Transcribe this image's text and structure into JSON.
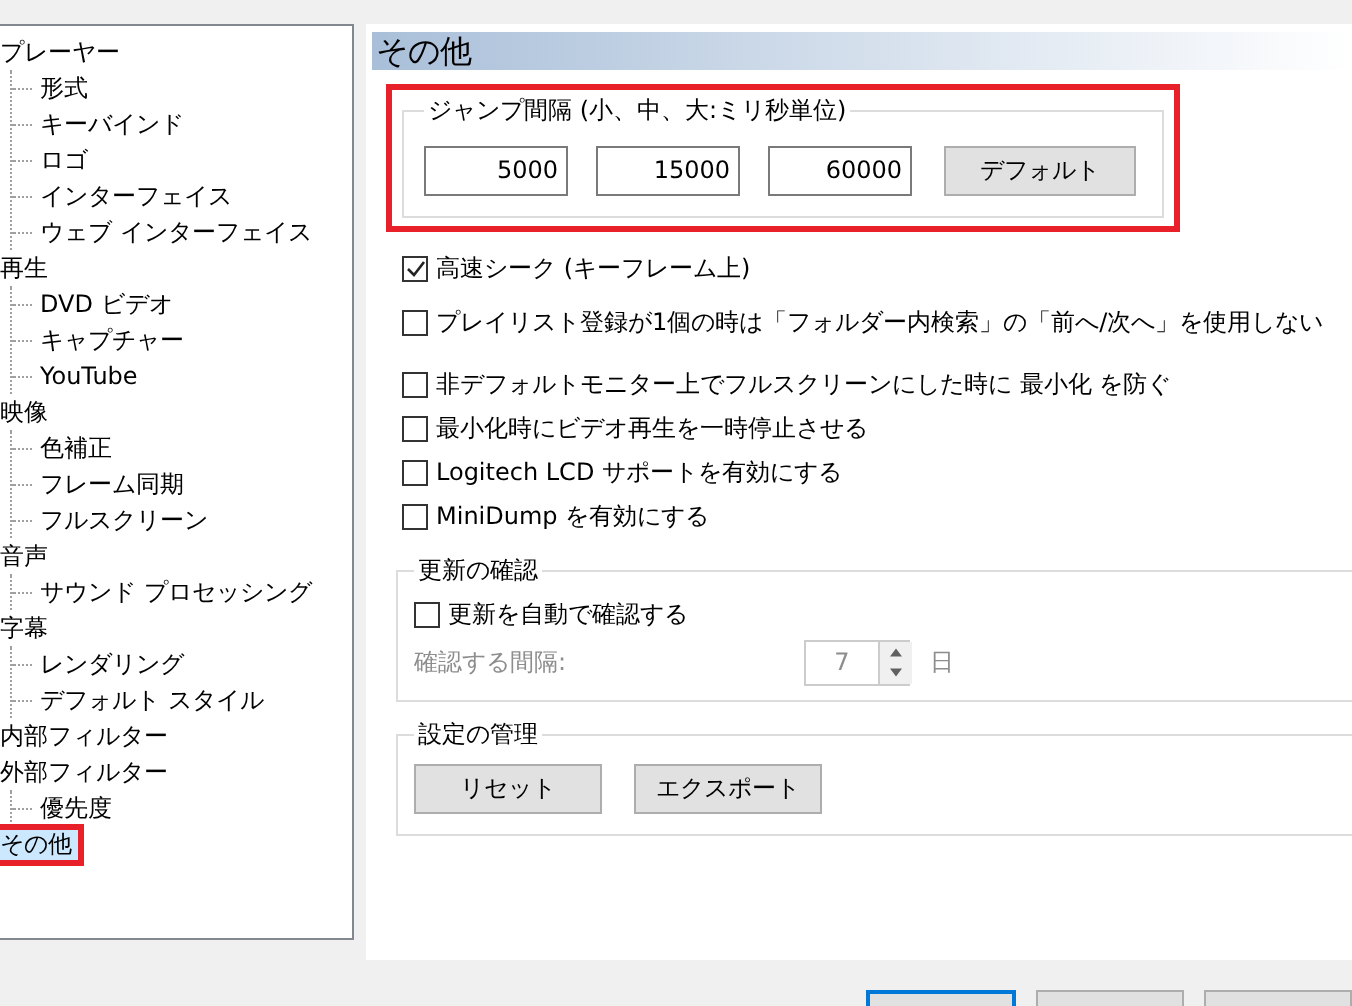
{
  "tree": [
    {
      "label": "プレーヤー",
      "selected": false,
      "highlighted": false,
      "children": [
        {
          "label": "形式",
          "selected": false
        },
        {
          "label": "キーバインド",
          "selected": false
        },
        {
          "label": "ロゴ",
          "selected": false
        },
        {
          "label": "インターフェイス",
          "selected": false
        },
        {
          "label": "ウェブ インターフェイス",
          "selected": false
        }
      ]
    },
    {
      "label": "再生",
      "selected": false,
      "highlighted": false,
      "children": [
        {
          "label": "DVD ビデオ",
          "selected": false
        },
        {
          "label": "キャプチャー",
          "selected": false
        },
        {
          "label": "YouTube",
          "selected": false
        }
      ]
    },
    {
      "label": "映像",
      "selected": false,
      "highlighted": false,
      "children": [
        {
          "label": "色補正",
          "selected": false
        },
        {
          "label": "フレーム同期",
          "selected": false
        },
        {
          "label": "フルスクリーン",
          "selected": false
        }
      ]
    },
    {
      "label": "音声",
      "selected": false,
      "highlighted": false,
      "children": [
        {
          "label": "サウンド プロセッシング",
          "selected": false
        }
      ]
    },
    {
      "label": "字幕",
      "selected": false,
      "highlighted": false,
      "children": [
        {
          "label": "レンダリング",
          "selected": false
        },
        {
          "label": "デフォルト スタイル",
          "selected": false
        }
      ]
    },
    {
      "label": "内部フィルター",
      "selected": false,
      "highlighted": false
    },
    {
      "label": "外部フィルター",
      "selected": false,
      "highlighted": false,
      "children": [
        {
          "label": "優先度",
          "selected": false
        }
      ]
    },
    {
      "label": "その他",
      "selected": true,
      "highlighted": true
    }
  ],
  "page_title": "その他",
  "jump_group": {
    "title": "ジャンプ間隔 (小、中、大:ミリ秒単位)",
    "highlighted": true,
    "values": [
      "5000",
      "15000",
      "60000"
    ],
    "button": "デフォルト"
  },
  "options": [
    {
      "label": "高速シーク (キーフレーム上)",
      "checked": true
    },
    {
      "label": "プレイリスト登録が1個の時は「フォルダー内検索」の「前へ/次へ」を使用しない",
      "checked": false
    },
    {
      "label": "非デフォルトモニター上でフルスクリーンにした時に 最小化 を防ぐ",
      "checked": false
    },
    {
      "label": "最小化時にビデオ再生を一時停止させる",
      "checked": false
    },
    {
      "label": "Logitech LCD サポートを有効にする",
      "checked": false
    },
    {
      "label": "MiniDump を有効にする",
      "checked": false
    }
  ],
  "update_group": {
    "title": "更新の確認",
    "auto_check": {
      "label": "更新を自動で確認する",
      "checked": false
    },
    "interval_label": "確認する間隔:",
    "interval_value": "7",
    "interval_unit": "日",
    "disabled": true
  },
  "settings_group": {
    "title": "設定の管理",
    "buttons": [
      "リセット",
      "エクスポート"
    ]
  },
  "dialog_buttons": [
    {
      "default": true
    },
    {
      "default": false
    },
    {
      "default": false
    }
  ]
}
